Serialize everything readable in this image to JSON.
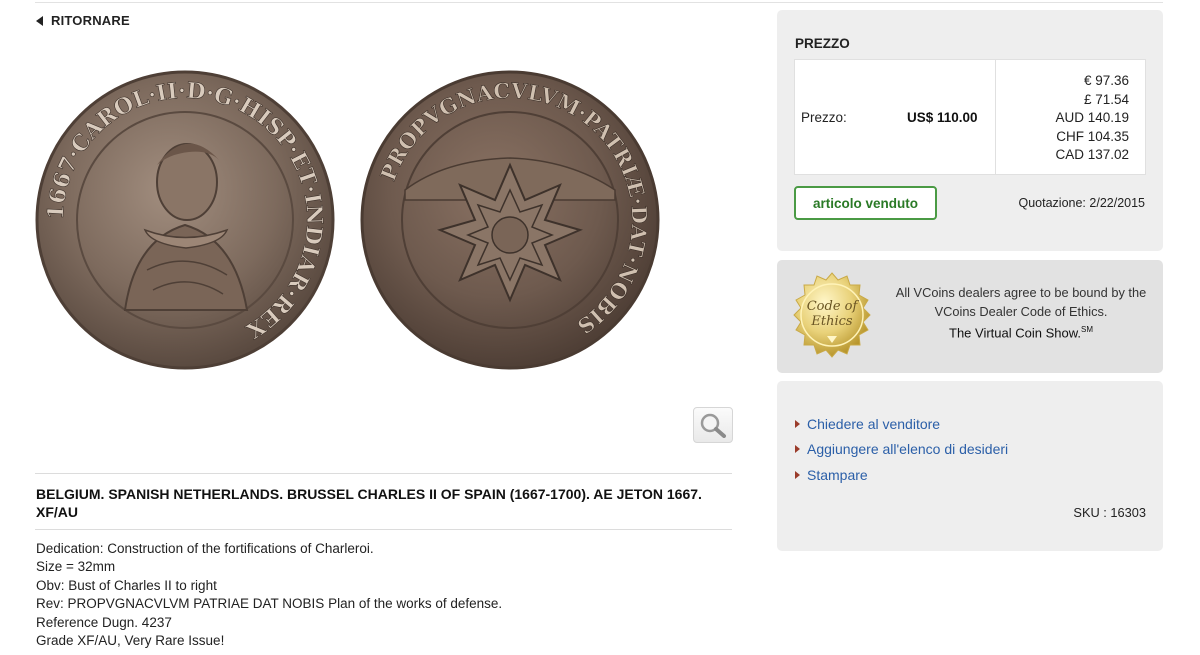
{
  "nav": {
    "back_label": "RITORNARE"
  },
  "product": {
    "title": "BELGIUM. SPANISH NETHERLANDS. BRUSSEL CHARLES II OF SPAIN (1667-1700). AE JETON 1667. XF/AU",
    "description": [
      "Dedication: Construction of the fortifications of Charleroi.",
      "Size = 32mm",
      "Obv: Bust of Charles II to right",
      "Rev: PROPVGNACVLVM PATRIAE DAT NOBIS Plan of the works of defense.",
      "Reference Dugn. 4237",
      "Grade XF/AU, Very Rare Issue!"
    ],
    "obverse_legend": "1667·CAROL·II·D·G·HISP·ET·INDIAR·REX",
    "reverse_legend": "PROPVGNACVLVM·PATRIÆ·DAT·NOBIS",
    "zoom_icon": "magnifier-icon"
  },
  "price_panel": {
    "heading": "PREZZO",
    "label": "Prezzo:",
    "usd": "US$ 110.00",
    "conversions": [
      "€ 97.36",
      "£ 71.54",
      "AUD 140.19",
      "CHF 104.35",
      "CAD 137.02"
    ],
    "sold_button": "articolo venduto",
    "quote_label": "Quotazione:",
    "quote_date": "2/22/2015"
  },
  "ethics": {
    "seal_text_1": "Code of",
    "seal_text_2": "Ethics",
    "line1": "All VCoins dealers agree to be bound by the VCoins Dealer Code of Ethics.",
    "show": "The Virtual Coin Show.",
    "sup": "SM"
  },
  "actions": {
    "links": [
      "Chiedere al venditore",
      "Aggiungere all'elenco di desideri",
      "Stampare"
    ],
    "sku_label": "SKU :",
    "sku": "16303"
  },
  "colors": {
    "link": "#2b5fa8",
    "sold_border": "#4a9a44",
    "panel_bg": "#eeeeee",
    "bullet": "#9a3b2a"
  }
}
